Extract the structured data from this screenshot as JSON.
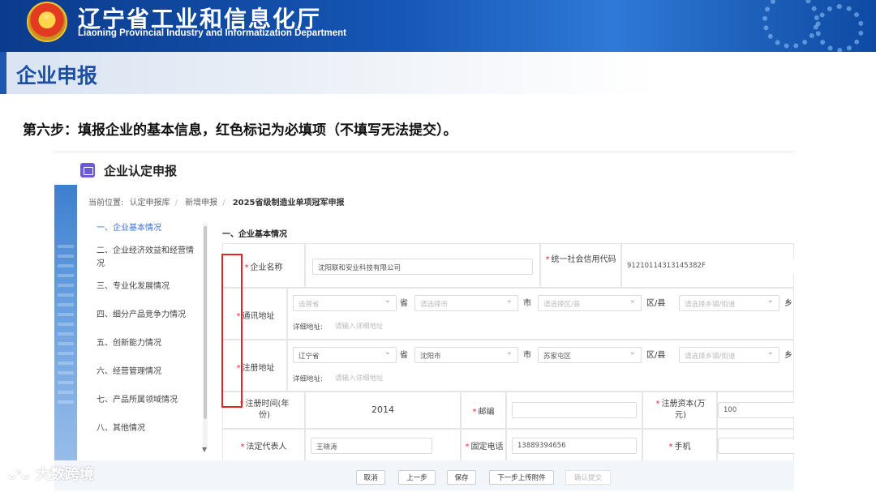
{
  "header": {
    "org_name_cn": "辽宁省工业和信息化厅",
    "org_name_en": "Liaoning Provincial Industry and Informatization Department",
    "colors": {
      "banner": "#1656b5",
      "accent": "#1c58b2"
    }
  },
  "section": {
    "title": "企业申报"
  },
  "instruction": "第六步：填报企业的基本信息，红色标记为必填项（不填写无法提交）。",
  "app": {
    "title": "企业认定申报",
    "breadcrumb": {
      "prefix": "当前位置:",
      "items": [
        "认定申报库",
        "新增申报",
        "2025省级制造业单项冠军申报"
      ]
    },
    "side_menu": [
      "一、企业基本情况",
      "二、企业经济效益和经营情况",
      "三、专业化发展情况",
      "四、细分产品竞争力情况",
      "五、创新能力情况",
      "六、经营管理情况",
      "七、产品所属领域情况",
      "八、其他情况"
    ],
    "form_heading": "一、企业基本情况",
    "required_mark": "*",
    "fields": {
      "company_name": {
        "label": "企业名称",
        "value": "沈阳联和安业科技有限公司"
      },
      "credit_code": {
        "label": "统一社会信用代码",
        "value": "91210114313145382F"
      },
      "mail_address": {
        "label": "通讯地址",
        "province": "选择省",
        "city": "请选择市",
        "district": "请选择区/县",
        "town": "请选择乡镇/街道",
        "detail_label": "详细地址:",
        "detail_placeholder": "请输入详细地址"
      },
      "reg_address": {
        "label": "注册地址",
        "province": "辽宁省",
        "city": "沈阳市",
        "district": "苏家屯区",
        "town": "请选择乡镇/街道",
        "detail_label": "详细地址:",
        "detail_placeholder": "请输入详细地址"
      },
      "units": {
        "province": "省",
        "city": "市",
        "district": "区/县",
        "town": "乡"
      },
      "reg_year": {
        "label": "注册时间(年份)",
        "value": "2014"
      },
      "postcode": {
        "label": "邮编",
        "value": ""
      },
      "reg_capital": {
        "label": "注册资本(万元)",
        "value": "100"
      },
      "legal_rep": {
        "label": "法定代表人",
        "value": "王晓涛"
      },
      "phone": {
        "label": "固定电话",
        "value": "13889394656"
      },
      "mobile": {
        "label": "手机",
        "value": ""
      }
    },
    "buttons": {
      "cancel": "取消",
      "prev": "上一步",
      "save": "保存",
      "next_upload": "下一步上传附件",
      "confirm_submit": "确认提交"
    }
  },
  "watermark": {
    "icon": "wechat-icon",
    "text": "大数跨境"
  }
}
